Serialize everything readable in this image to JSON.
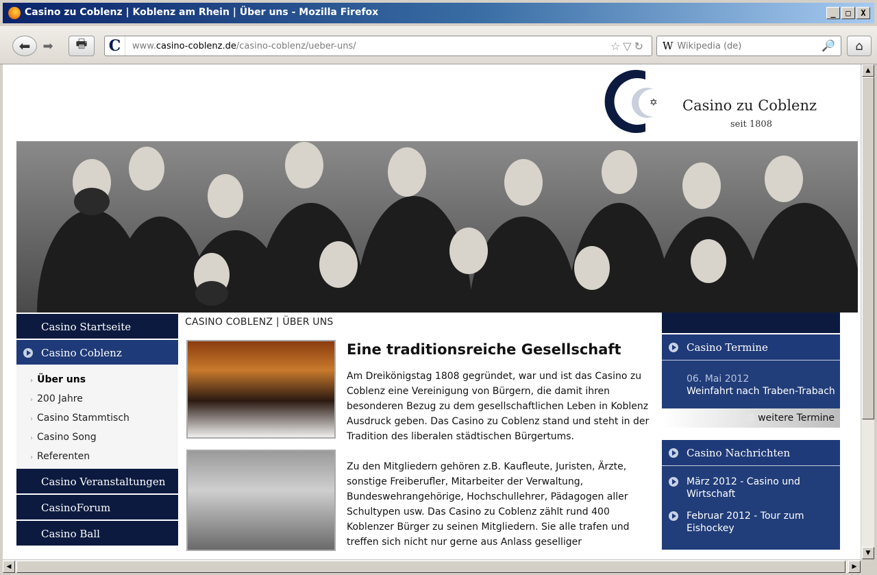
{
  "window": {
    "title": "Casino zu Coblenz | Koblenz am Rhein | Über uns - Mozilla Firefox",
    "minimize": "_",
    "maximize": "□",
    "close": "X"
  },
  "toolbar": {
    "url_prefix": "www.",
    "url_domain": "casino-coblenz.de",
    "url_path": "/casino-coblenz/ueber-uns/",
    "site_icon": "C",
    "search_engine": "W",
    "search_placeholder": "Wikipedia (de)",
    "back_icon": "back-arrow-icon",
    "forward_icon": "forward-arrow-icon"
  },
  "logo": {
    "name": "Casino zu Coblenz",
    "since": "seit 1808",
    "star": "✡"
  },
  "nav": {
    "items": [
      {
        "label": "Casino Startseite"
      },
      {
        "label": "Casino Coblenz"
      },
      {
        "label": "Casino Veranstaltungen"
      },
      {
        "label": "CasinoForum"
      },
      {
        "label": "Casino Ball"
      }
    ],
    "sub_items": [
      {
        "label": "Über uns"
      },
      {
        "label": "200 Jahre"
      },
      {
        "label": "Casino Stammtisch"
      },
      {
        "label": "Casino Song"
      },
      {
        "label": "Referenten"
      }
    ]
  },
  "main": {
    "breadcrumb": "CASINO COBLENZ  |  ÜBER UNS",
    "title": "Eine traditionsreiche Gesellschaft",
    "paragraph1": "Am Dreikönigstag 1808 gegründet, war und ist das Casino zu Coblenz eine Vereinigung von Bürgern, die damit ihren besonderen Bezug zu dem gesellschaftlichen Leben in Koblenz Ausdruck geben. Das Casino zu Coblenz stand und steht in der Tradition des liberalen städtischen Bürgertums.",
    "paragraph2": "Zu den Mitgliedern gehören z.B. Kaufleute, Juristen, Ärzte, sonstige Freiberufler, Mitarbeiter der Verwaltung, Bundeswehrangehörige, Hochschullehrer, Pädagogen aller Schultypen usw. Das Casino zu Coblenz zählt rund 400 Koblenzer Bürger zu seinen Mitgliedern. Sie alle trafen und treffen sich nicht nur gerne aus Anlass geselliger"
  },
  "sidebar": {
    "termine_header": "Casino Termine",
    "event_date": "06. Mai 2012",
    "event_title": "Weinfahrt nach Traben-Trabach",
    "more_termine": "weitere Termine",
    "news_header": "Casino Nachrichten",
    "news": [
      {
        "label": "März 2012 - Casino und Wirtschaft"
      },
      {
        "label": "Februar 2012 - Tour zum Eishockey"
      }
    ]
  },
  "colors": {
    "nav_dark": "#0c1a3f",
    "nav_active": "#1f3a78",
    "titlebar": "#0a246a"
  }
}
